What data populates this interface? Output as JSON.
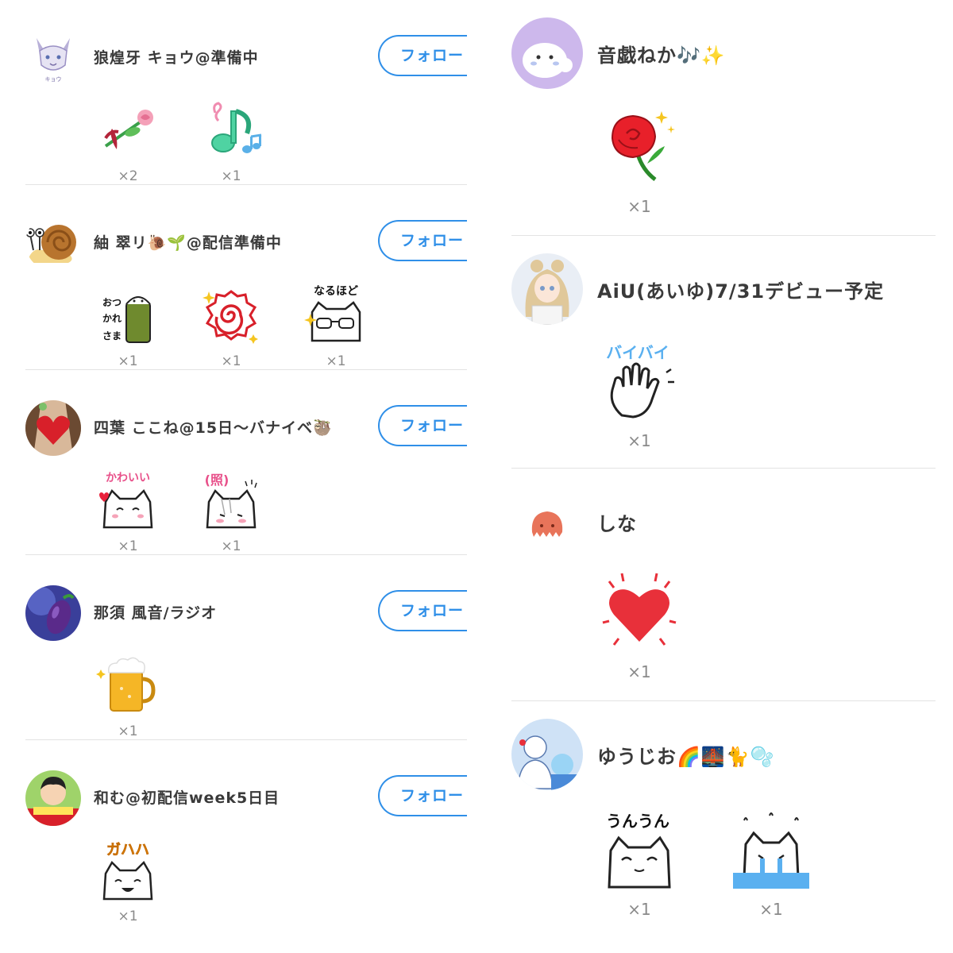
{
  "follow_label": "フォロー",
  "left_entries": [
    {
      "name": "狼煌牙 キョウ@準備中",
      "avatar_icon": "wolf-avatar-icon",
      "gifts": [
        {
          "icon": "rose-bouquet-icon",
          "count": "×2"
        },
        {
          "icon": "music-note-icon",
          "count": "×1"
        }
      ]
    },
    {
      "name": "紬 翠リ🐌🌱@配信準備中",
      "avatar_icon": "snail-avatar-icon",
      "gifts": [
        {
          "icon": "otsukaresama-cat-sticker-icon",
          "label": "おつかれさま",
          "count": "×1"
        },
        {
          "icon": "naruto-swirl-icon",
          "count": "×1"
        },
        {
          "icon": "narhodo-cat-sticker-icon",
          "label": "なるほど",
          "count": "×1"
        }
      ]
    },
    {
      "name": "四葉 ここね@15日〜バナイベ🦥",
      "avatar_icon": "heart-avatar-icon",
      "gifts": [
        {
          "icon": "kawaii-cat-sticker-icon",
          "label": "かわいい",
          "count": "×1"
        },
        {
          "icon": "tere-cat-sticker-icon",
          "label": "(照)",
          "count": "×1"
        }
      ]
    },
    {
      "name": "那須 風音/ラジオ",
      "avatar_icon": "eggplant-avatar-icon",
      "gifts": [
        {
          "icon": "beer-mug-icon",
          "count": "×1"
        }
      ]
    },
    {
      "name": "和む@初配信week5日目",
      "avatar_icon": "boy-avatar-icon",
      "gifts": [
        {
          "icon": "gahaha-cat-sticker-icon",
          "label": "ガハハ",
          "count": "×1"
        }
      ]
    }
  ],
  "right_entries": [
    {
      "name": "音戯ねか🎶✨",
      "avatar_icon": "seal-avatar-icon",
      "gifts": [
        {
          "icon": "red-rose-icon",
          "count": "×1"
        }
      ]
    },
    {
      "name": "AiU(あいゆ)7/31デビュー予定",
      "avatar_icon": "vtuber-girl-avatar-icon",
      "gifts": [
        {
          "icon": "byebye-hand-sticker-icon",
          "label": "バイバイ",
          "count": "×1"
        }
      ]
    },
    {
      "name": "しな",
      "avatar_icon": "octopus-avatar-icon",
      "gifts": [
        {
          "icon": "red-heart-icon",
          "count": "×1"
        }
      ]
    },
    {
      "name": "ゆうじお🌈🌉🐈🫧",
      "avatar_icon": "snowman-avatar-icon",
      "gifts": [
        {
          "icon": "unun-cat-sticker-icon",
          "label": "うんうん",
          "count": "×1"
        },
        {
          "icon": "crying-cat-sticker-icon",
          "count": "×1"
        }
      ]
    }
  ],
  "colors": {
    "accent": "#2f8fe8",
    "divider": "#e3e3e3",
    "count_text": "#8a8a8a"
  }
}
